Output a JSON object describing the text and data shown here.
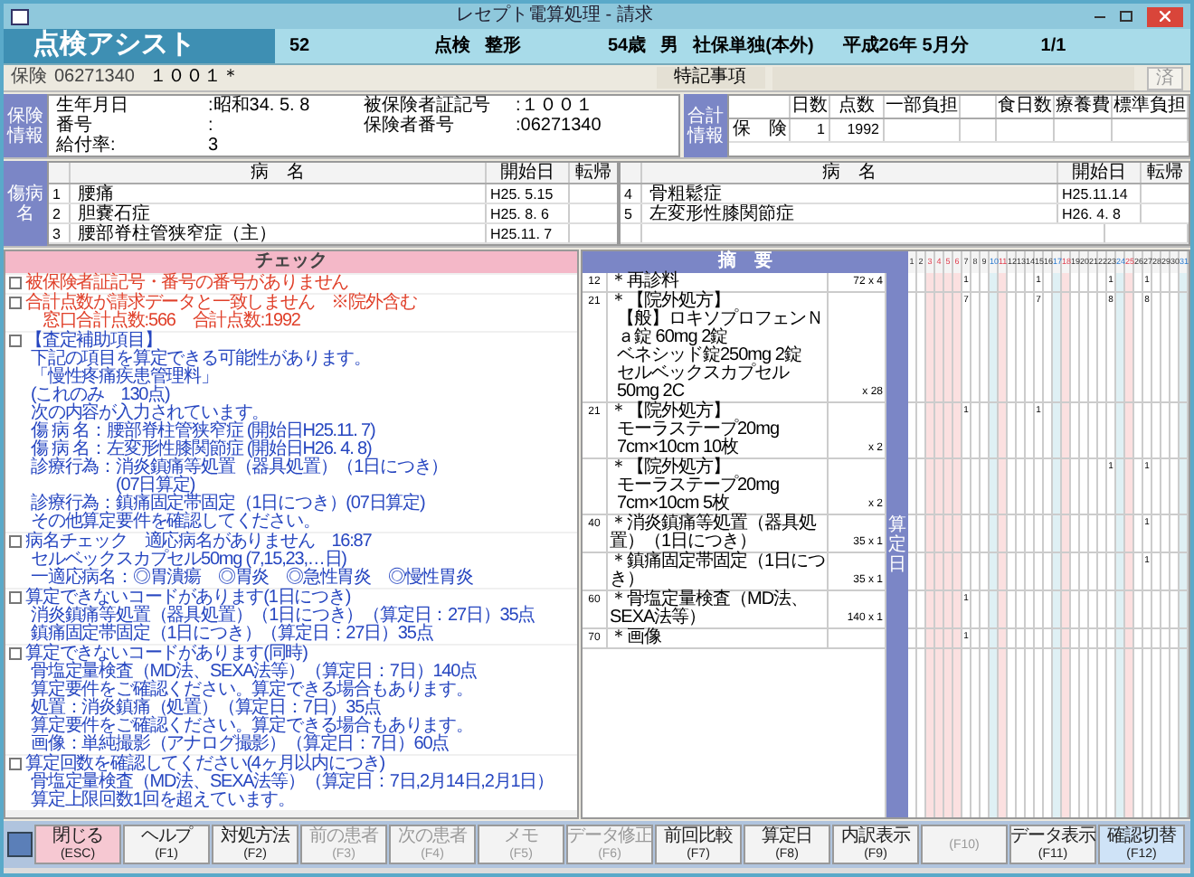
{
  "window": {
    "title": "レセプト電算処理 - 請求"
  },
  "header": {
    "app": "点検アシスト",
    "number": "52",
    "mode": "点検",
    "department": "整形",
    "age": "54歳",
    "sex": "男",
    "insurance_type": "社保単独(本外)",
    "month": "平成26年 5月分",
    "page": "1/1"
  },
  "insurance_row": {
    "label": "保険",
    "insurer": "06271340",
    "symbol": "１００１＊",
    "notes_label": "特記事項",
    "done_button": "済"
  },
  "insurance_info": {
    "label": "保険情報",
    "lines": [
      {
        "label": "生年月日",
        "value": ":昭和34. 5. 8"
      },
      {
        "label": "被保険者証記号",
        "value": ":１００１"
      },
      {
        "label": "番号",
        "value": ":"
      },
      {
        "label": "保険者番号",
        "value": ":06271340"
      },
      {
        "label": "給付率:",
        "value": "3"
      }
    ]
  },
  "totals": {
    "label": "合計情報",
    "columns": [
      "日数",
      "点数",
      "一部負担",
      "",
      "食日数",
      "療養費",
      "標準負担"
    ],
    "rows": [
      {
        "label": "保　険",
        "cells": [
          "1",
          "1992",
          "",
          "",
          "",
          "",
          ""
        ]
      }
    ]
  },
  "diseases": {
    "label": "傷病名",
    "tables": [
      {
        "columns": [
          "病　名",
          "開始日",
          "転帰"
        ],
        "rows": [
          {
            "no": "1",
            "name": "腰痛",
            "start": "H25. 5.15"
          },
          {
            "no": "2",
            "name": "胆嚢石症",
            "start": "H25. 8. 6"
          },
          {
            "no": "3",
            "name": "腰部脊柱管狭窄症（主）",
            "start": "H25.11. 7"
          }
        ]
      },
      {
        "columns": [
          "病　名",
          "開始日",
          "転帰"
        ],
        "rows": [
          {
            "no": "4",
            "name": "骨粗鬆症",
            "start": "H25.11.14"
          },
          {
            "no": "5",
            "name": "左変形性膝関節症",
            "start": "H26. 4. 8"
          }
        ]
      }
    ]
  },
  "check_panel": {
    "title": "チェック",
    "items": [
      {
        "kind": "error",
        "checked": false,
        "lines": [
          "被保険者証記号・番号の番号がありません"
        ]
      },
      {
        "kind": "error",
        "checked": false,
        "lines": [
          "合計点数が請求データと一致しません　※院外含む",
          "　窓口合計点数:566　合計点数:1992"
        ]
      },
      {
        "kind": "info",
        "checked": false,
        "lines": [
          "【査定補助項目】",
          "下記の項目を算定できる可能性があります。",
          "「慢性疼痛疾患管理料」",
          "(これのみ　130点)",
          "次の内容が入力されています。",
          "傷 病 名：腰部脊柱管狭窄症 (開始日H25.11. 7)",
          "傷 病 名：左変形性膝関節症 (開始日H26. 4. 8)",
          "診療行為：消炎鎮痛等処置（器具処置）（1日につき）",
          "　　　　　(07日算定)",
          "診療行為：鎮痛固定帯固定（1日につき）(07日算定)",
          "その他算定要件を確認してください。"
        ]
      },
      {
        "kind": "info",
        "checked": false,
        "lines": [
          "病名チェック　適応病名がありません　16:87",
          "セルベックスカプセル50mg (7,15,23,…日)",
          "一適応病名：◎胃潰瘍　◎胃炎　◎急性胃炎　◎慢性胃炎"
        ]
      },
      {
        "kind": "info",
        "checked": false,
        "lines": [
          "算定できないコードがあります(1日につき)",
          "消炎鎮痛等処置（器具処置）（1日につき）（算定日：27日）35点",
          "鎮痛固定帯固定（1日につき）（算定日：27日）35点"
        ]
      },
      {
        "kind": "info",
        "checked": false,
        "lines": [
          "算定できないコードがあります(同時)",
          "骨塩定量検査（MD法、SEXA法等）（算定日：7日）140点",
          "算定要件をご確認ください。算定できる場合もあります。",
          "処置：消炎鎮痛（処置）（算定日：7日）35点",
          "算定要件をご確認ください。算定できる場合もあります。",
          "画像：単純撮影（アナログ撮影）（算定日：7日）60点"
        ]
      },
      {
        "kind": "info",
        "checked": false,
        "lines": [
          "算定回数を確認してください(4ヶ月以内につき)",
          "骨塩定量検査（MD法、SEXA法等）（算定日：7日,2月14日,2月1日）",
          "算定上限回数1回を超えています。"
        ]
      }
    ]
  },
  "treatment_panel": {
    "title": "摘　要",
    "side_label": "算定日"
  },
  "calendar_days": [
    {
      "label": "1",
      "kind": "weekday"
    },
    {
      "label": "2",
      "kind": "weekday"
    },
    {
      "label": "3",
      "kind": "holiday"
    },
    {
      "label": "4",
      "kind": "holiday"
    },
    {
      "label": "5",
      "kind": "holiday"
    },
    {
      "label": "6",
      "kind": "holiday"
    },
    {
      "label": "7",
      "kind": "weekday"
    },
    {
      "label": "8",
      "kind": "weekday"
    },
    {
      "label": "9",
      "kind": "weekday"
    },
    {
      "label": "10",
      "kind": "saturday"
    },
    {
      "label": "11",
      "kind": "holiday"
    },
    {
      "label": "12",
      "kind": "weekday"
    },
    {
      "label": "13",
      "kind": "weekday"
    },
    {
      "label": "14",
      "kind": "weekday"
    },
    {
      "label": "15",
      "kind": "weekday"
    },
    {
      "label": "16",
      "kind": "weekday"
    },
    {
      "label": "17",
      "kind": "saturday"
    },
    {
      "label": "18",
      "kind": "holiday"
    },
    {
      "label": "19",
      "kind": "weekday"
    },
    {
      "label": "20",
      "kind": "weekday"
    },
    {
      "label": "21",
      "kind": "weekday"
    },
    {
      "label": "22",
      "kind": "weekday"
    },
    {
      "label": "23",
      "kind": "weekday"
    },
    {
      "label": "24",
      "kind": "saturday"
    },
    {
      "label": "25",
      "kind": "holiday"
    },
    {
      "label": "26",
      "kind": "weekday"
    },
    {
      "label": "27",
      "kind": "weekday"
    },
    {
      "label": "28",
      "kind": "weekday"
    },
    {
      "label": "29",
      "kind": "weekday"
    },
    {
      "label": "30",
      "kind": "weekday"
    },
    {
      "label": "31",
      "kind": "saturday"
    }
  ],
  "treatments": [
    {
      "code": "12",
      "lines": [
        "＊再診料"
      ],
      "amount": "72 x 4",
      "counts": {
        "7": "1",
        "15": "1",
        "23": "1",
        "27": "1"
      }
    },
    {
      "code": "21",
      "lines": [
        "＊【院外処方】",
        "【般】ロキソプロフェンＮａ錠 60mg 2錠",
        "ベネシッド錠250mg 2錠",
        "セルベックスカプセル50mg 2C"
      ],
      "amount": "x 28",
      "counts": {
        "7": "7",
        "15": "7",
        "23": "8",
        "27": "8"
      }
    },
    {
      "code": "21",
      "lines": [
        "＊【院外処方】",
        "モーラステープ20mg 7cm×10cm 10枚"
      ],
      "amount": "x 2",
      "counts": {
        "7": "1",
        "15": "1"
      }
    },
    {
      "lines": [
        "＊【院外処方】",
        "モーラステープ20mg 7cm×10cm 5枚"
      ],
      "amount": "x 2",
      "counts": {
        "23": "1",
        "27": "1"
      }
    },
    {
      "code": "40",
      "lines": [
        "＊消炎鎮痛等処置（器具処置）（1日につき）"
      ],
      "amount": "35 x 1",
      "counts": {
        "27": "1"
      }
    },
    {
      "lines": [
        "＊鎮痛固定帯固定（1日につき）"
      ],
      "amount": "35 x 1",
      "counts": {
        "27": "1"
      }
    },
    {
      "code": "60",
      "lines": [
        "＊骨塩定量検査（MD法、SEXA法等）"
      ],
      "amount": "140 x 1",
      "counts": {
        "7": "1"
      }
    },
    {
      "code": "70",
      "lines": [
        "＊画像"
      ],
      "counts": {
        "7": "1"
      }
    }
  ],
  "function_keys": [
    {
      "label": "閉じる",
      "key": "(ESC)",
      "kind": "close",
      "disabled": false
    },
    {
      "label": "ヘルプ",
      "key": "(F1)",
      "kind": "normal",
      "disabled": false
    },
    {
      "label": "対処方法",
      "key": "(F2)",
      "kind": "normal",
      "disabled": false
    },
    {
      "label": "前の患者",
      "key": "(F3)",
      "kind": "normal",
      "disabled": true
    },
    {
      "label": "次の患者",
      "key": "(F4)",
      "kind": "normal",
      "disabled": true
    },
    {
      "label": "メモ",
      "key": "(F5)",
      "kind": "normal",
      "disabled": true
    },
    {
      "label": "データ修正",
      "key": "(F6)",
      "kind": "normal",
      "disabled": true
    },
    {
      "label": "前回比較",
      "key": "(F7)",
      "kind": "normal",
      "disabled": false
    },
    {
      "label": "算定日",
      "key": "(F8)",
      "kind": "normal",
      "disabled": false
    },
    {
      "label": "内訳表示",
      "key": "(F9)",
      "kind": "normal",
      "disabled": false
    },
    {
      "key": "(F10)",
      "kind": "normal",
      "disabled": true
    },
    {
      "label": "データ表示",
      "key": "(F11)",
      "kind": "normal",
      "disabled": false
    },
    {
      "label": "確認切替",
      "key": "(F12)",
      "kind": "toggle",
      "disabled": false
    }
  ]
}
